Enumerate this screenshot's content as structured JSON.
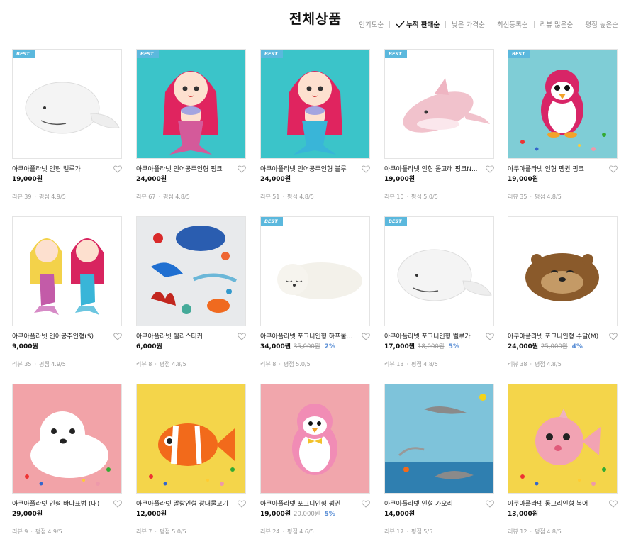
{
  "page_title": "전체상품",
  "sort_options": [
    {
      "label": "인기도순",
      "active": false
    },
    {
      "label": "누적 판매순",
      "active": true
    },
    {
      "label": "낮은 가격순",
      "active": false
    },
    {
      "label": "최신등록순",
      "active": false
    },
    {
      "label": "리뷰 많은순",
      "active": false
    },
    {
      "label": "평점 높은순",
      "active": false
    }
  ],
  "badge_label": "BEST",
  "products": [
    {
      "name": "아쿠아플라넷 인형 벨루가",
      "price": "19,000원",
      "orig": "",
      "disc": "",
      "best": true,
      "review_label": "리뷰",
      "reviews": "39",
      "rating_label": "평점",
      "rating": "4.9/5",
      "bg": "#ffffff",
      "kind": "beluga"
    },
    {
      "name": "아쿠아플라넷 인어공주인형 핑크",
      "price": "24,000원",
      "orig": "",
      "disc": "",
      "best": true,
      "review_label": "리뷰",
      "reviews": "67",
      "rating_label": "평점",
      "rating": "4.8/5",
      "bg": "#3bc4c9",
      "kind": "mermaid-pink"
    },
    {
      "name": "아쿠아플라넷 인어공주인형 블루",
      "price": "24,000원",
      "orig": "",
      "disc": "",
      "best": true,
      "review_label": "리뷰",
      "reviews": "51",
      "rating_label": "평점",
      "rating": "4.8/5",
      "bg": "#3bc4c9",
      "kind": "mermaid-blue"
    },
    {
      "name": "아쿠아플라넷 인형 돌고래 핑크N...",
      "price": "19,000원",
      "orig": "",
      "disc": "",
      "best": true,
      "review_label": "리뷰",
      "reviews": "10",
      "rating_label": "평점",
      "rating": "5.0/5",
      "bg": "#ffffff",
      "kind": "dolphin"
    },
    {
      "name": "아쿠아플라넷 인형 펭귄 핑크",
      "price": "19,000원",
      "orig": "",
      "disc": "",
      "best": true,
      "review_label": "리뷰",
      "reviews": "35",
      "rating_label": "평점",
      "rating": "4.8/5",
      "bg": "#7fcdd6",
      "kind": "penguin-pink"
    },
    {
      "name": "아쿠아플라넷 인어공주인형(S)",
      "price": "9,000원",
      "orig": "",
      "disc": "",
      "best": false,
      "review_label": "리뷰",
      "reviews": "35",
      "rating_label": "평점",
      "rating": "4.9/5",
      "bg": "#ffffff",
      "kind": "mermaid-duo"
    },
    {
      "name": "아쿠아플라넷 젤리스티커",
      "price": "6,000원",
      "orig": "",
      "disc": "",
      "best": false,
      "review_label": "리뷰",
      "reviews": "8",
      "rating_label": "평점",
      "rating": "4.8/5",
      "bg": "#e8eaec",
      "kind": "stickers"
    },
    {
      "name": "아쿠아플라넷 포그니인형 하프물...",
      "price": "34,000원",
      "orig": "35,000원",
      "disc": "2%",
      "best": true,
      "review_label": "리뷰",
      "reviews": "8",
      "rating_label": "평점",
      "rating": "5.0/5",
      "bg": "#ffffff",
      "kind": "seal-lying"
    },
    {
      "name": "아쿠아플라넷 포그니인형 벨루가",
      "price": "17,000원",
      "orig": "18,000원",
      "disc": "5%",
      "best": true,
      "review_label": "리뷰",
      "reviews": "13",
      "rating_label": "평점",
      "rating": "4.8/5",
      "bg": "#ffffff",
      "kind": "beluga2"
    },
    {
      "name": "아쿠아플라넷 포그니인형 수달(M)",
      "price": "24,000원",
      "orig": "25,000원",
      "disc": "4%",
      "best": false,
      "review_label": "리뷰",
      "reviews": "38",
      "rating_label": "평점",
      "rating": "4.8/5",
      "bg": "#ffffff",
      "kind": "otter"
    },
    {
      "name": "아쿠아플라넷 인형 바다표범 (대)",
      "price": "29,000원",
      "orig": "",
      "disc": "",
      "best": false,
      "review_label": "리뷰",
      "reviews": "9",
      "rating_label": "평점",
      "rating": "4.9/5",
      "bg": "#f2a3a8",
      "kind": "seal"
    },
    {
      "name": "아쿠아플라넷 말랑인형 광대물고기",
      "price": "12,000원",
      "orig": "",
      "disc": "",
      "best": false,
      "review_label": "리뷰",
      "reviews": "7",
      "rating_label": "평점",
      "rating": "5.0/5",
      "bg": "#f4d54a",
      "kind": "clownfish"
    },
    {
      "name": "아쿠아플라넷 포그니인형 펭귄",
      "price": "19,000원",
      "orig": "20,000원",
      "disc": "5%",
      "best": false,
      "review_label": "리뷰",
      "reviews": "24",
      "rating_label": "평점",
      "rating": "4.6/5",
      "bg": "#f1a6ac",
      "kind": "penguin2"
    },
    {
      "name": "아쿠아플라넷 인형 가오리",
      "price": "14,000원",
      "orig": "",
      "disc": "",
      "best": false,
      "review_label": "리뷰",
      "reviews": "17",
      "rating_label": "평점",
      "rating": "5/5",
      "bg": "#8ccbe0",
      "kind": "ray"
    },
    {
      "name": "아쿠아플라넷 동그리인형 복어",
      "price": "13,000원",
      "orig": "",
      "disc": "",
      "best": false,
      "review_label": "리뷰",
      "reviews": "12",
      "rating_label": "평점",
      "rating": "4.8/5",
      "bg": "#f4d54a",
      "kind": "pufferfish"
    }
  ]
}
